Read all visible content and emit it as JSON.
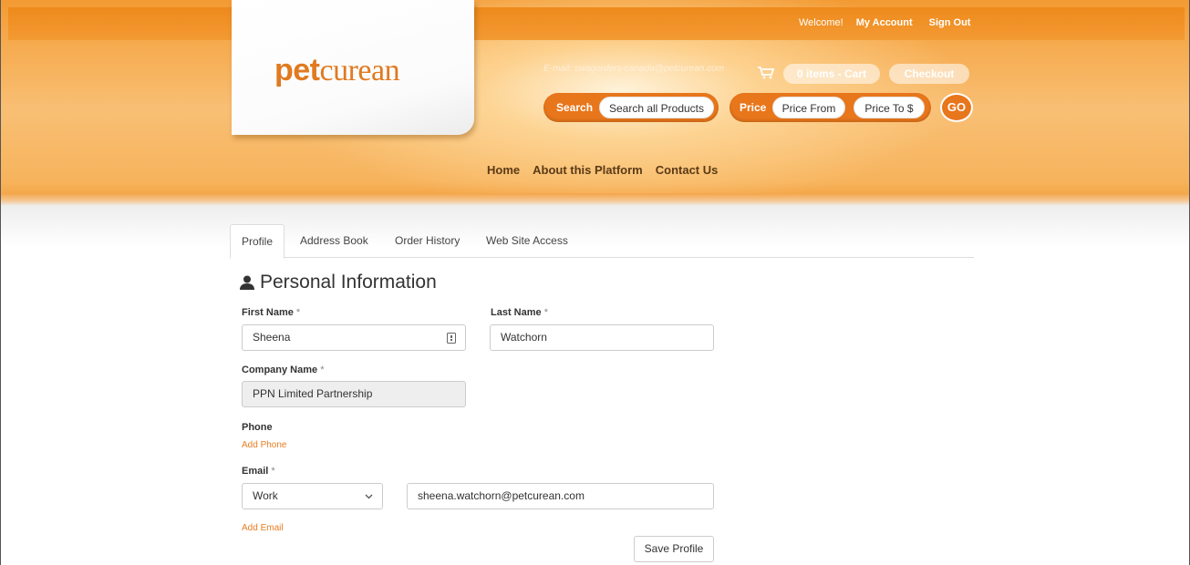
{
  "header": {
    "welcome": "Welcome!",
    "my_account": "My Account",
    "sign_out": "Sign Out",
    "logo_bold": "pet",
    "logo_light": "curean",
    "email_line": "E-mail: swagorders-canada@petcurean.com",
    "cart_label": "0 items - Cart",
    "checkout_label": "Checkout",
    "search_label": "Search",
    "search_placeholder": "Search all Products",
    "price_label": "Price",
    "price_from": "Price From",
    "price_to": "Price To $",
    "go_label": "GO",
    "accent_color": "#e8761b"
  },
  "nav": {
    "items": [
      "Home",
      "About this Platform",
      "Contact Us"
    ]
  },
  "tabs": [
    "Profile",
    "Address Book",
    "Order History",
    "Web Site Access"
  ],
  "profile": {
    "section_title": "Personal Information",
    "first_name_label": "First Name",
    "first_name_value": "Sheena",
    "last_name_label": "Last Name",
    "last_name_value": "Watchorn",
    "company_label": "Company Name",
    "company_value": "PPN Limited Partnership",
    "required_mark": "*",
    "phone_label": "Phone",
    "add_phone": "Add Phone",
    "email_label": "Email",
    "email_type": "Work",
    "email_value": "sheena.watchorn@petcurean.com",
    "add_email": "Add Email",
    "save_label": "Save Profile"
  }
}
